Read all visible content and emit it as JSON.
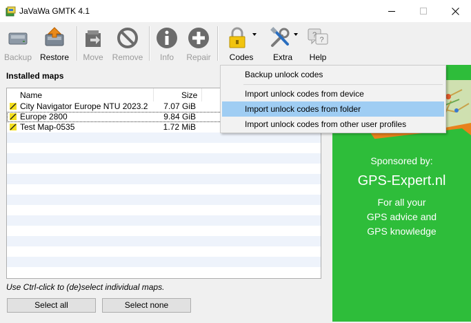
{
  "window": {
    "title": "JaVaWa GMTK 4.1",
    "controls": [
      "minimize-icon",
      "maximize-icon",
      "close-icon"
    ]
  },
  "toolbar": {
    "buttons": [
      {
        "label": "Backup",
        "icon": "backup-icon",
        "enabled": false
      },
      {
        "label": "Restore",
        "icon": "restore-icon",
        "enabled": true
      },
      {
        "label": "Move",
        "icon": "move-icon",
        "enabled": false
      },
      {
        "label": "Remove",
        "icon": "remove-icon",
        "enabled": false
      },
      {
        "label": "Info",
        "icon": "info-icon",
        "enabled": false
      },
      {
        "label": "Repair",
        "icon": "repair-icon",
        "enabled": false
      },
      {
        "label": "Codes",
        "icon": "lock-icon",
        "enabled": true,
        "active": true
      },
      {
        "label": "Extra",
        "icon": "tools-icon",
        "enabled": true
      },
      {
        "label": "Help",
        "icon": "help-icon",
        "enabled": true
      }
    ]
  },
  "maps": {
    "title": "Installed maps",
    "columns": {
      "name": "Name",
      "size": "Size"
    },
    "rows": [
      {
        "name": "City Navigator Europe NTU 2023.2",
        "size": "7.07 GiB"
      },
      {
        "name": "Europe 2800",
        "size": "9.84 GiB"
      },
      {
        "name": "Test Map-0535",
        "size": "1.72 MiB"
      }
    ],
    "hint": "Use Ctrl-click to (de)select individual maps.",
    "select_all": "Select all",
    "select_none": "Select none"
  },
  "codes_menu": {
    "items": [
      "Backup unlock codes",
      "Import unlock codes from device",
      "Import unlock codes from folder",
      "Import unlock codes from other user profiles"
    ],
    "highlighted_index": 2
  },
  "sponsor": {
    "sponsored_by": "Sponsored by:",
    "brand": "GPS-Expert.nl",
    "tagline": [
      "For all your",
      "GPS advice and",
      "GPS knowledge"
    ],
    "bg_color": "#2ebd3a"
  }
}
